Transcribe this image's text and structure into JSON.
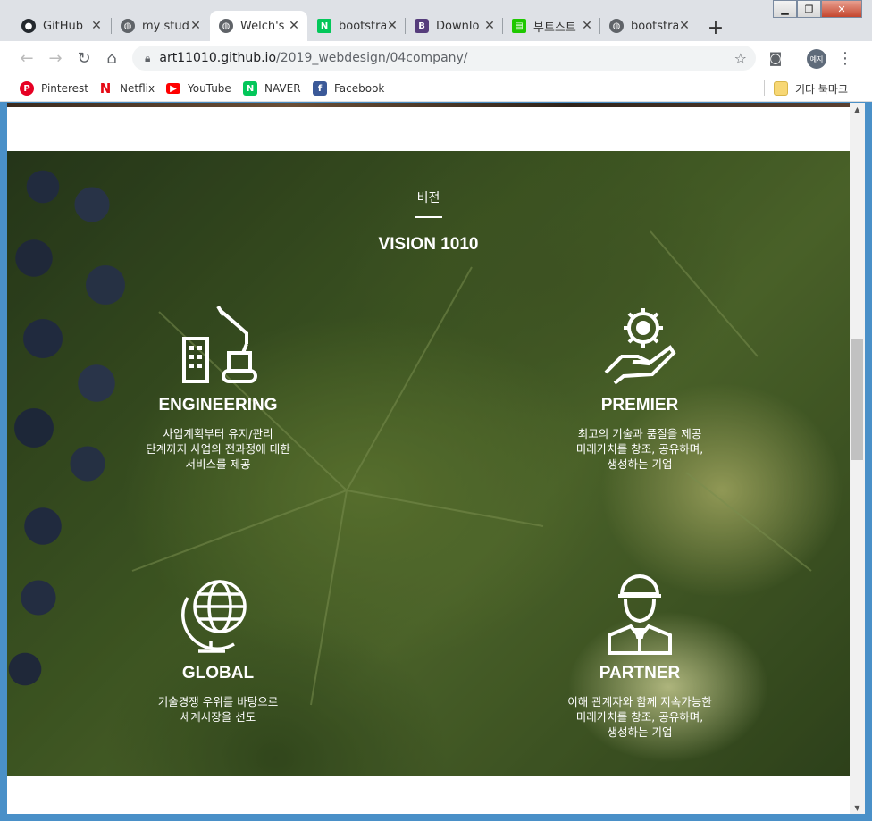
{
  "browser": {
    "tabs": [
      {
        "title": "GitHub",
        "icon": "github-icon"
      },
      {
        "title": "my stud",
        "icon": "globe-icon"
      },
      {
        "title": "Welch's",
        "icon": "globe-icon",
        "active": true
      },
      {
        "title": "bootstra",
        "icon": "naver-icon"
      },
      {
        "title": "Downlo",
        "icon": "bootstrap-icon"
      },
      {
        "title": "부트스트",
        "icon": "green-doc-icon"
      },
      {
        "title": "bootstra",
        "icon": "globe-icon"
      }
    ],
    "url_host": "art11010.github.io",
    "url_path": "/2019_webdesign/04company/",
    "profile_label": "예지",
    "bookmarks": [
      {
        "label": "Pinterest",
        "icon": "pinterest-icon",
        "color": "#e60023"
      },
      {
        "label": "Netflix",
        "icon": "netflix-icon",
        "color": "#e50914"
      },
      {
        "label": "YouTube",
        "icon": "youtube-icon",
        "color": "#ff0000"
      },
      {
        "label": "NAVER",
        "icon": "naver-icon",
        "color": "#03c75a"
      },
      {
        "label": "Facebook",
        "icon": "facebook-icon",
        "color": "#3b5998"
      }
    ],
    "other_bookmarks": "기타 북마크"
  },
  "page": {
    "section_sub": "비전",
    "section_title": "VISION 1010",
    "features": [
      {
        "title": "ENGINEERING",
        "icon": "construction-icon",
        "desc": [
          "사업계획부터 유지/관리",
          "단계까지 사업의 전과정에 대한",
          "서비스를 제공"
        ]
      },
      {
        "title": "PREMIER",
        "icon": "gear-hand-icon",
        "desc": [
          "최고의 기술과 품질을 제공",
          "미래가치를 창조, 공유하며,",
          "생성하는 기업"
        ]
      },
      {
        "title": "GLOBAL",
        "icon": "globe-icon",
        "desc": [
          "기술경쟁 우위를 바탕으로",
          "세계시장을 선도"
        ]
      },
      {
        "title": "PARTNER",
        "icon": "worker-icon",
        "desc": [
          "이해 관계자와 함께 지속가능한",
          "미래가치를 창조, 공유하며,",
          "생성하는 기업"
        ]
      }
    ]
  }
}
